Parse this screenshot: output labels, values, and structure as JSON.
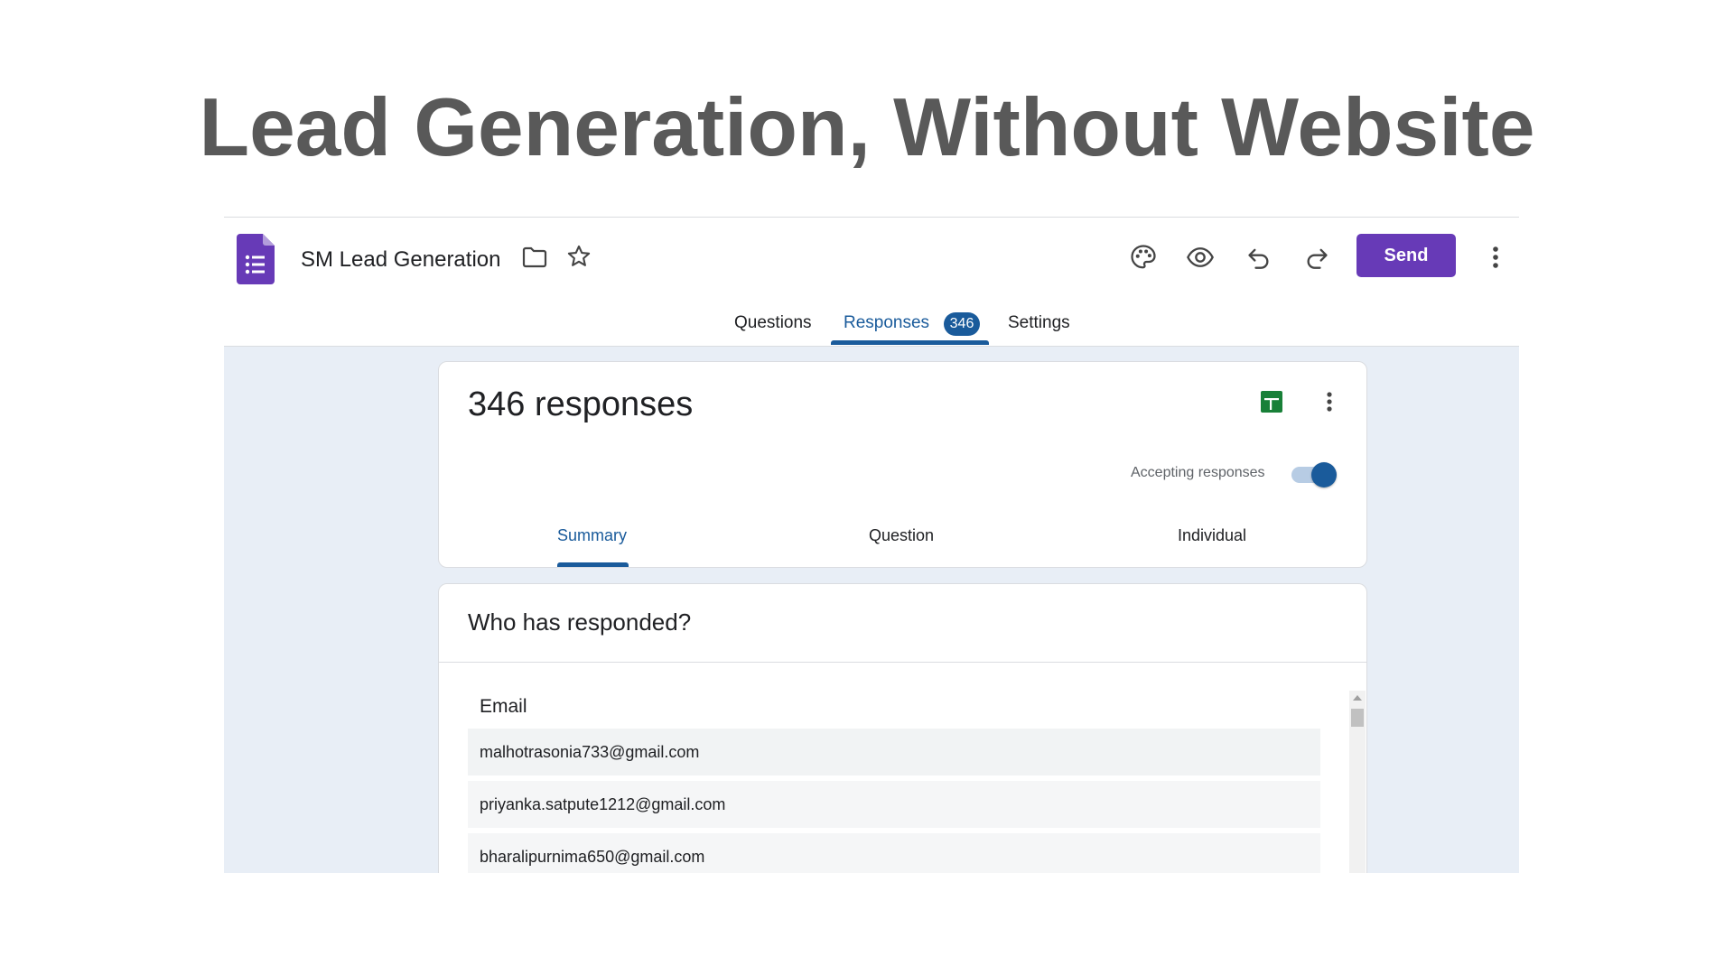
{
  "slide": {
    "title": "Lead Generation, Without Website"
  },
  "header": {
    "doc_title": "SM Lead Generation",
    "send_label": "Send",
    "icons": [
      "forms-logo-icon",
      "folder-icon",
      "star-icon",
      "palette-icon",
      "eye-icon",
      "undo-icon",
      "redo-icon",
      "more-vert-icon"
    ]
  },
  "tabs": {
    "questions": "Questions",
    "responses": "Responses",
    "responses_badge": "346",
    "settings": "Settings"
  },
  "summary_card": {
    "count_text": "346 responses",
    "accepting_label": "Accepting responses",
    "accepting": true,
    "subtabs": {
      "summary": "Summary",
      "question": "Question",
      "individual": "Individual"
    }
  },
  "who_card": {
    "heading": "Who has responded?",
    "column_label": "Email",
    "emails": [
      "malhotrasonia733@gmail.com",
      "priyanka.satpute1212@gmail.com",
      "bharalipurnima650@gmail.com"
    ]
  },
  "colors": {
    "accent": "#673ab7",
    "primary": "#1a5b9b",
    "sheets": "#188038",
    "background": "#e8eef6"
  }
}
